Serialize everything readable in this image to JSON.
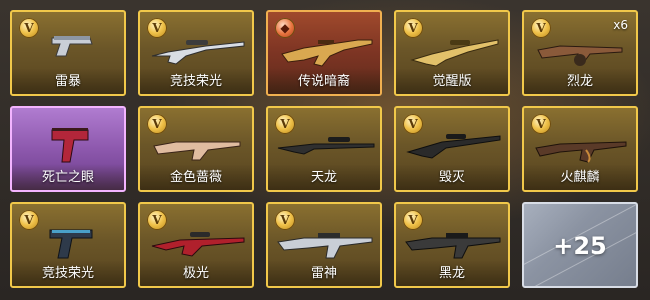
{
  "items": [
    {
      "name": "雷暴",
      "rarity": "gold",
      "badge": "V",
      "icon": "pistol-icon"
    },
    {
      "name": "竞技荣光",
      "rarity": "gold",
      "badge": "V",
      "icon": "sniper-rifle-icon"
    },
    {
      "name": "传说暗裔",
      "rarity": "legendary",
      "badge": "",
      "icon": "assault-rifle-icon"
    },
    {
      "name": "觉醒版",
      "rarity": "gold",
      "badge": "V",
      "icon": "sniper-rifle-icon"
    },
    {
      "name": "烈龙",
      "rarity": "gold",
      "badge": "V",
      "icon": "tommy-gun-icon",
      "count": "x6"
    },
    {
      "name": "死亡之眼",
      "rarity": "purple",
      "badge": "",
      "icon": "smg-icon"
    },
    {
      "name": "金色蔷薇",
      "rarity": "gold",
      "badge": "V",
      "icon": "assault-rifle-icon"
    },
    {
      "name": "天龙",
      "rarity": "gold",
      "badge": "V",
      "icon": "sniper-rifle-icon"
    },
    {
      "name": "毁灭",
      "rarity": "gold",
      "badge": "V",
      "icon": "heavy-sniper-icon"
    },
    {
      "name": "火麒麟",
      "rarity": "gold",
      "badge": "V",
      "icon": "ak-rifle-icon"
    },
    {
      "name": "竞技荣光",
      "rarity": "gold",
      "badge": "V",
      "icon": "pistol-icon"
    },
    {
      "name": "极光",
      "rarity": "gold",
      "badge": "V",
      "icon": "sniper-rifle-icon"
    },
    {
      "name": "雷神",
      "rarity": "gold",
      "badge": "V",
      "icon": "m4-rifle-icon"
    },
    {
      "name": "黑龙",
      "rarity": "gold",
      "badge": "V",
      "icon": "m4-rifle-icon"
    }
  ],
  "more": {
    "label": "+25"
  },
  "colors": {
    "gold_border": "#f1c84a",
    "legend_border": "#f0b050",
    "purple_border": "#f3b4ff",
    "more_border": "#d8dde6"
  }
}
